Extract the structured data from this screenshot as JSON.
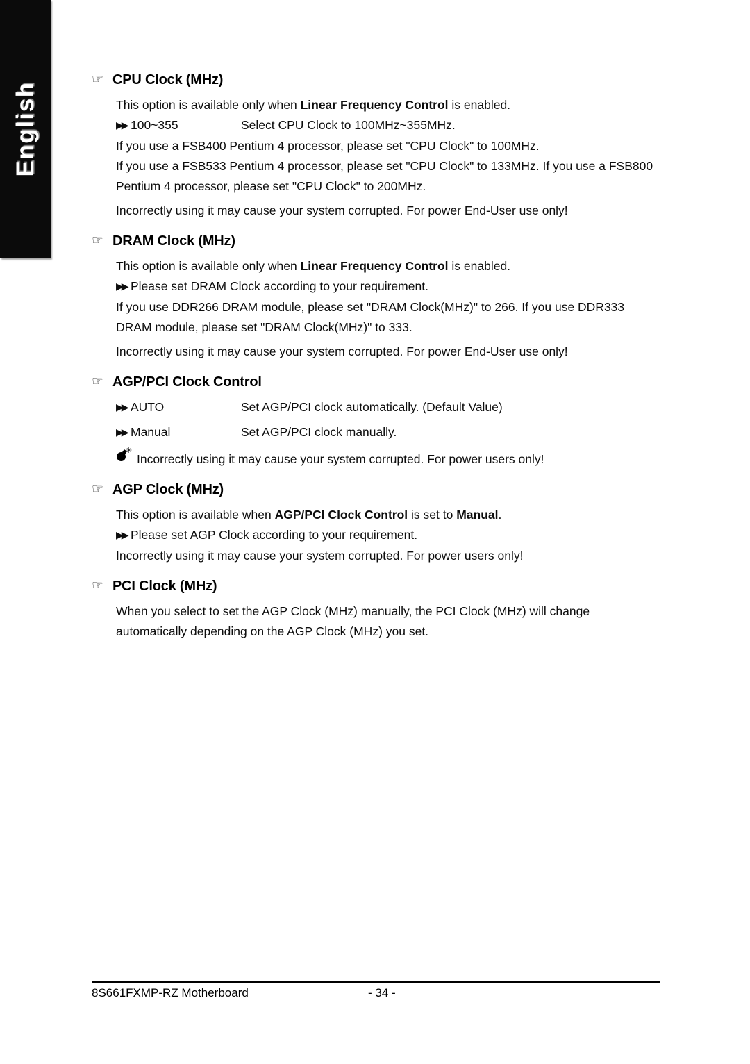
{
  "sidebar": {
    "language_label": "English"
  },
  "icons": {
    "hand": "☞",
    "double_triangle": "▶▶",
    "bomb": "bomb-icon"
  },
  "sections": [
    {
      "id": "cpu-clock",
      "heading": "CPU Clock (MHz)",
      "intro_pre": "This option is available only when ",
      "intro_bold": "Linear Frequency Control",
      "intro_post": " is enabled.",
      "option_name": "100~355",
      "option_desc": "Select CPU Clock to 100MHz~355MHz.",
      "note1": "If you use a FSB400 Pentium 4 processor, please set \"CPU Clock\" to 100MHz.",
      "note2": "If you use a FSB533 Pentium 4 processor, please set \"CPU Clock\" to 133MHz. If you use a FSB800 Pentium 4 processor, please set \"CPU Clock\" to 200MHz.",
      "warning": "Incorrectly using it may cause your system corrupted. For power End-User use only!"
    },
    {
      "id": "dram-clock",
      "heading": "DRAM Clock (MHz)",
      "intro_pre": "This option is available only when ",
      "intro_bold": "Linear Frequency Control",
      "intro_post": " is enabled.",
      "option_desc": "Please set DRAM Clock according to your requirement.",
      "note1": "If you use DDR266 DRAM module, please set \"DRAM Clock(MHz)\" to 266. If you use DDR333 DRAM module, please set \"DRAM Clock(MHz)\" to 333.",
      "warning": "Incorrectly using it may cause your system corrupted. For power End-User use only!"
    },
    {
      "id": "agp-pci-clock-control",
      "heading": "AGP/PCI Clock Control",
      "options": [
        {
          "name": "AUTO",
          "desc": "Set AGP/PCI clock automatically. (Default Value)"
        },
        {
          "name": "Manual",
          "desc": "Set AGP/PCI clock manually."
        }
      ],
      "warning": "Incorrectly using it may cause your system corrupted. For power users only!"
    },
    {
      "id": "agp-clock",
      "heading": "AGP Clock (MHz)",
      "intro_pre": "This option is available when ",
      "intro_bold": "AGP/PCI Clock Control",
      "intro_mid": " is set to ",
      "intro_bold2": "Manual",
      "intro_post": ".",
      "option_desc": "Please set AGP Clock according to your requirement.",
      "warning": "Incorrectly using it may cause your system corrupted. For power users only!"
    },
    {
      "id": "pci-clock",
      "heading": "PCI Clock (MHz)",
      "body": "When you select to set the AGP Clock (MHz) manually, the PCI Clock (MHz) will change automatically depending on the AGP Clock (MHz) you set."
    }
  ],
  "footer": {
    "product": "8S661FXMP-RZ Motherboard",
    "page_number": "- 34 -"
  }
}
